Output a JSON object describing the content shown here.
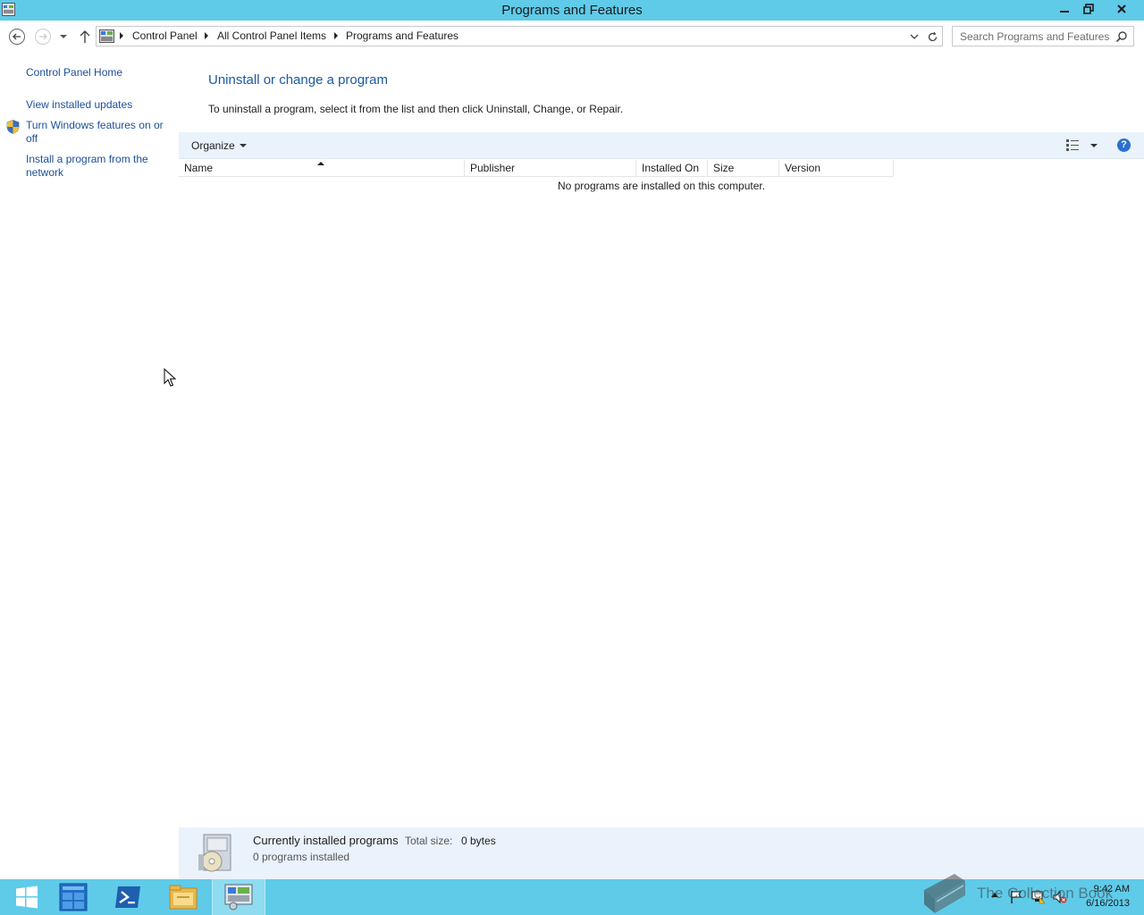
{
  "window": {
    "title": "Programs and Features"
  },
  "address": {
    "crumbs": [
      "Control Panel",
      "All Control Panel Items",
      "Programs and Features"
    ],
    "search_placeholder": "Search Programs and Features"
  },
  "sidebar": {
    "items": [
      {
        "label": "Control Panel Home"
      },
      {
        "label": "View installed updates"
      },
      {
        "label": "Turn Windows features on or off",
        "icon": "shield-icon"
      },
      {
        "label": "Install a program from the network"
      }
    ]
  },
  "main": {
    "title": "Uninstall or change a program",
    "description": "To uninstall a program, select it from the list and then click Uninstall, Change, or Repair.",
    "toolbar": {
      "organize_label": "Organize"
    },
    "columns": [
      "Name",
      "Publisher",
      "Installed On",
      "Size",
      "Version"
    ],
    "sort": {
      "column": "Name",
      "direction": "ascending"
    },
    "empty_message": "No programs are installed on this computer."
  },
  "details": {
    "title": "Currently installed programs",
    "size_label": "Total size:",
    "size_value": "0 bytes",
    "count_text": "0 programs installed"
  },
  "taskbar": {
    "apps": [
      "start-icon",
      "server-manager-icon",
      "powershell-icon",
      "file-explorer-icon",
      "control-panel-icon"
    ],
    "active_app": "control-panel-icon",
    "clock_time": "9:42 AM",
    "clock_date": "6/16/2013"
  },
  "watermark": {
    "text": "The Collection Book"
  },
  "colors": {
    "accent": "#5fcbe9",
    "link": "#1c4f9c",
    "heading": "#1c5aa0",
    "panel": "#eaf2fb"
  }
}
